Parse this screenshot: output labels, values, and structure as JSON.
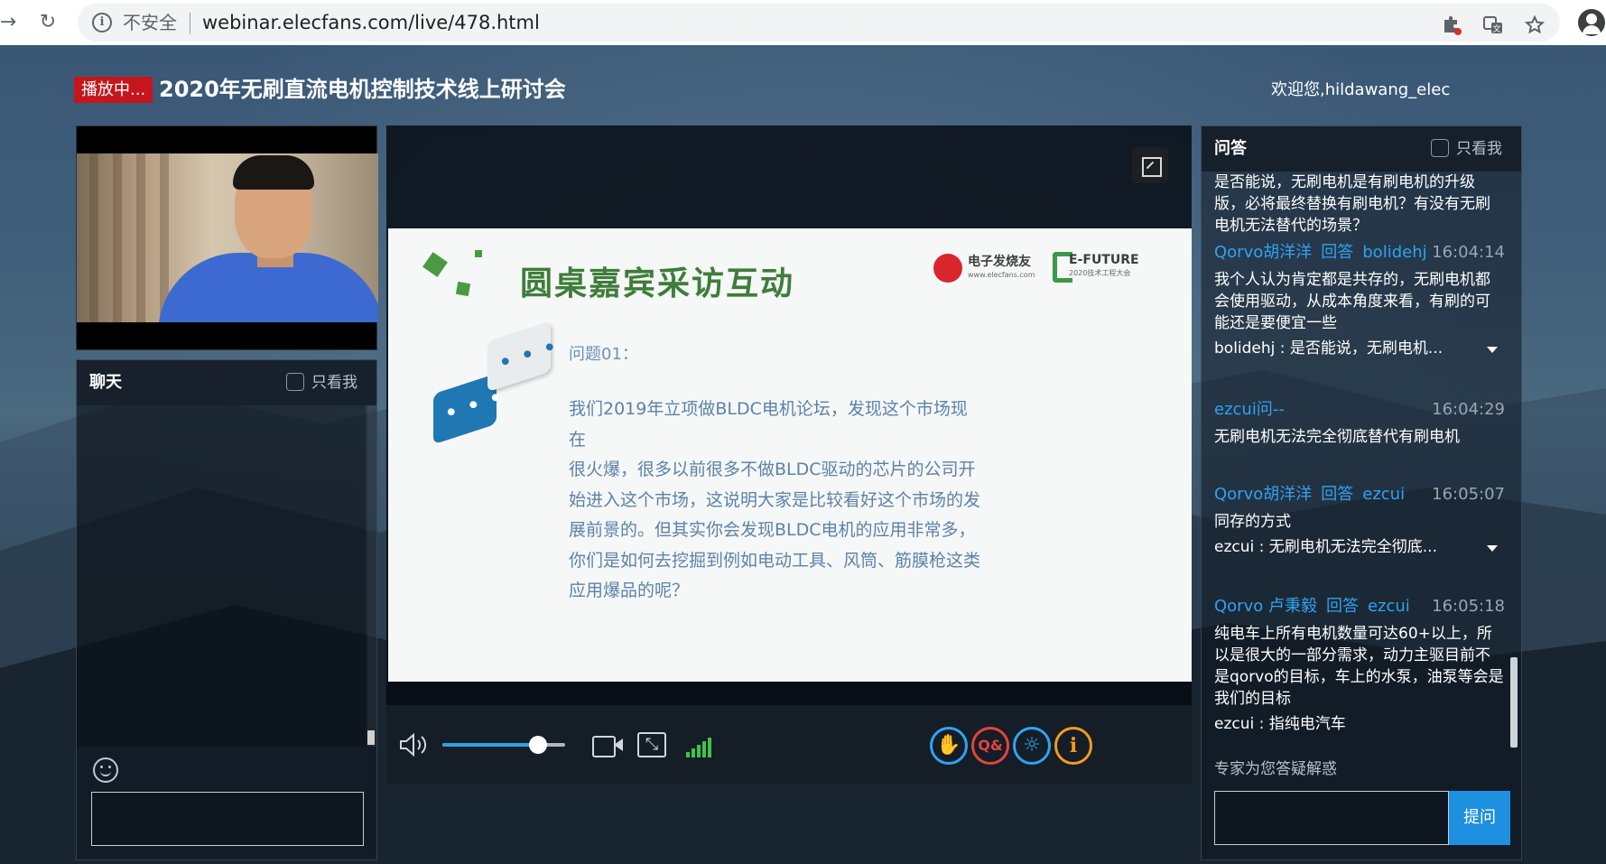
{
  "browser": {
    "back_glyph": "→",
    "reload_glyph": "↻",
    "security_label": "不安全",
    "url": "webinar.elecfans.com/live/478.html",
    "icons": [
      "extension-icon",
      "translate-icon",
      "star-icon",
      "profile-icon"
    ]
  },
  "header": {
    "live_badge": "播放中...",
    "title": "2020年无刷直流电机控制技术线上研讨会",
    "welcome": "欢迎您,hildawang_elec"
  },
  "chat": {
    "title": "聊天",
    "only_me": "只看我",
    "input_placeholder": ""
  },
  "slide": {
    "title": "圆桌嘉宾采访互动",
    "logo_left_main": "电子发烧友",
    "logo_left_sub": "www.elecfans.com",
    "logo_right_main": "E-FUTURE",
    "logo_right_sub": "2020技术工程大会",
    "question_label": "问题01：",
    "question_lines": [
      "我们2019年立项做BLDC电机论坛，发现这个市场现在",
      "很火爆，很多以前很多不做BLDC驱动的芯片的公司开",
      "始进入这个市场，这说明大家是比较看好这个市场的发",
      "展前景的。但其实你会发现BLDC电机的应用非常多，",
      "你们是如何去挖掘到例如电动工具、风筒、筋膜枪这类",
      "应用爆品的呢？"
    ]
  },
  "player": {
    "volume_percent": 78,
    "signal_bars": 5,
    "pip_glyph": "⤡"
  },
  "qa": {
    "title": "问答",
    "only_me": "只看我",
    "top_fragment": "是否能说，无刷电机是有刷电机的升级版，必将最终替换有刷电机？有没有无刷电机无法替代的场景？",
    "entries": [
      {
        "asker": "Qorvo胡洋洋",
        "verb": "回答",
        "target": "bolidehj",
        "time": "16:04:14",
        "text": "我个人认为肯定都是共存的，无刷电机都会使用驱动，从成本角度来看，有刷的可能还是要便宜一些",
        "quote": "bolidehj : 是否能说，无刷电机..."
      },
      {
        "asker": "ezcui问--",
        "verb": "",
        "target": "",
        "time": "16:04:29",
        "text": "无刷电机无法完全彻底替代有刷电机",
        "quote": ""
      },
      {
        "asker": "Qorvo胡洋洋",
        "verb": "回答",
        "target": "ezcui",
        "time": "16:05:07",
        "text": "同存的方式",
        "quote": "ezcui : 无刷电机无法完全彻底..."
      },
      {
        "asker": "Qorvo 卢秉毅",
        "verb": "回答",
        "target": "ezcui",
        "time": "16:05:18",
        "text": "纯电车上所有电机数量可达60+以上，所以是很大的一部分需求，动力主驱目前不是qorvo的目标，车上的水泵，油泵等会是我们的目标",
        "quote": "ezcui : 指纯电汽车"
      }
    ],
    "hint": "专家为您答疑解惑",
    "submit_label": "提问"
  },
  "colors": {
    "accent_blue": "#2ea3f2",
    "live_red": "#c4161c",
    "slide_green": "#3e7d3a",
    "submit_blue": "#1e90e0"
  }
}
